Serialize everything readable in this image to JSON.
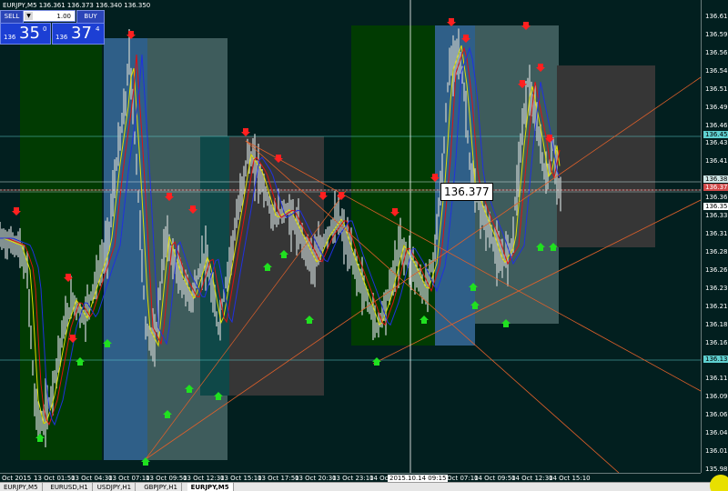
{
  "window": {
    "ohlc_text": "EURJPY,M5  136.361 136.373 136.340 136.350"
  },
  "trade_panel": {
    "sell_label": "SELL",
    "buy_label": "BUY",
    "quantity": "1.00",
    "bid_prefix": "136",
    "bid_big": "35",
    "bid_sup": "0",
    "ask_prefix": "136",
    "ask_big": "37",
    "ask_sup": "4"
  },
  "cursor": {
    "price": "136.377",
    "time": "2015.10.14 09:15"
  },
  "price_axis": {
    "ticks": [
      "136.615",
      "136.590",
      "136.565",
      "136.540",
      "136.515",
      "136.490",
      "136.465",
      "136.435",
      "136.410",
      "136.385",
      "136.360",
      "136.335",
      "136.310",
      "136.285",
      "136.260",
      "136.235",
      "136.210",
      "136.185",
      "136.165",
      "136.140",
      "136.115",
      "136.090",
      "136.065",
      "136.040",
      "136.015",
      "135.985"
    ],
    "labels": [
      {
        "text": "136.451",
        "value": 136.451,
        "color": "#5fd0d0"
      },
      {
        "text": "136.388",
        "value": 136.388,
        "color": "#cfe6e6"
      },
      {
        "text": "136.377",
        "value": 136.377,
        "color": "#d04848"
      },
      {
        "text": "136.350",
        "value": 136.35,
        "color": "#ffffff"
      },
      {
        "text": "136.138",
        "value": 136.138,
        "color": "#5fd0d0"
      }
    ]
  },
  "time_axis": {
    "ticks": [
      "Oct 2015",
      "13 Oct 01:50",
      "13 Oct 04:30",
      "13 Oct 07:10",
      "13 Oct 09:50",
      "13 Oct 12:30",
      "13 Oct 15:10",
      "13 Oct 17:50",
      "13 Oct 20:30",
      "13 Oct 23:10",
      "14 Oct 01",
      "14 Oct 07:10",
      "14 Oct 09:50",
      "14 Oct 12:30",
      "14 Oct 15:10"
    ]
  },
  "tabs": [
    "EURJPY,M5",
    "EURUSD,H1",
    "USDJPY,H1",
    "GBPJPY,H1",
    "EURJPY,M5"
  ],
  "colors": {
    "background": "#021f1f",
    "candles": "#b9c2c2",
    "sell_arrow": "#ff2020",
    "buy_arrow": "#20e020",
    "ma_red": "#e01010",
    "ma_yellow": "#e0e000",
    "ma_blue": "#2030e0",
    "trendline": "#e0602a"
  }
}
